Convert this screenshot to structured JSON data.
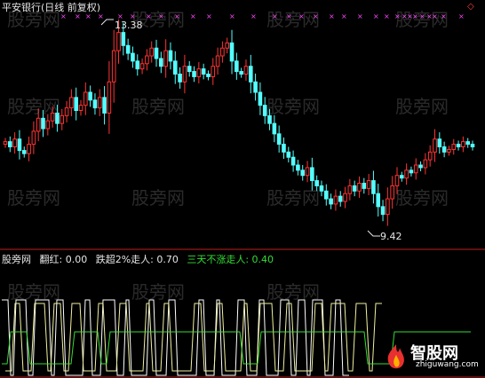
{
  "title": "平安银行(日线 前复权)",
  "price_chart": {
    "high_label": "13.38",
    "low_label": "9.42",
    "corner_symbol": "◇"
  },
  "indicator": {
    "name": "股旁网",
    "line1": "翻红: 0.00",
    "line2": "跌超2%走人: 0.70",
    "line3": "三天不涨走人: 0.40"
  },
  "watermark": "股旁网",
  "logo": {
    "name": "智股网",
    "url": "zhiguwang.com"
  },
  "colors": {
    "up": "#ff3333",
    "down": "#54ffff",
    "marker": "#ff44ff",
    "axis": "#c02020",
    "ind_line1": "#ffffff",
    "ind_line2": "#f0f0a0",
    "ind_line3": "#33dd33"
  },
  "chart_data": {
    "type": "candlestick",
    "high_annotation": 13.38,
    "low_annotation": 9.42,
    "close": [
      11.15,
      11.05,
      11.2,
      10.98,
      10.92,
      11.1,
      11.35,
      11.6,
      11.4,
      11.55,
      11.7,
      11.5,
      11.65,
      11.8,
      12.0,
      11.75,
      11.85,
      12.1,
      11.95,
      11.8,
      12.0,
      11.7,
      12.3,
      12.9,
      13.25,
      13.0,
      12.85,
      12.7,
      12.55,
      12.65,
      12.8,
      12.95,
      12.75,
      12.6,
      12.9,
      12.7,
      12.45,
      12.3,
      12.6,
      12.5,
      12.4,
      12.55,
      12.45,
      12.4,
      12.6,
      12.8,
      12.95,
      13.05,
      12.7,
      12.5,
      12.45,
      12.6,
      12.3,
      12.1,
      11.85,
      11.65,
      11.5,
      11.3,
      11.1,
      10.95,
      10.85,
      10.7,
      10.6,
      10.5,
      10.65,
      10.4,
      10.3,
      10.2,
      10.05,
      9.95,
      10.1,
      10.0,
      10.15,
      10.3,
      10.2,
      10.35,
      10.25,
      10.4,
      10.15,
      9.9,
      9.75,
      10.05,
      10.3,
      10.5,
      10.45,
      10.6,
      10.55,
      10.7,
      10.65,
      10.8,
      10.95,
      11.2,
      11.05,
      10.95,
      11.0,
      11.1,
      11.05,
      11.15,
      11.1,
      11.05
    ]
  }
}
